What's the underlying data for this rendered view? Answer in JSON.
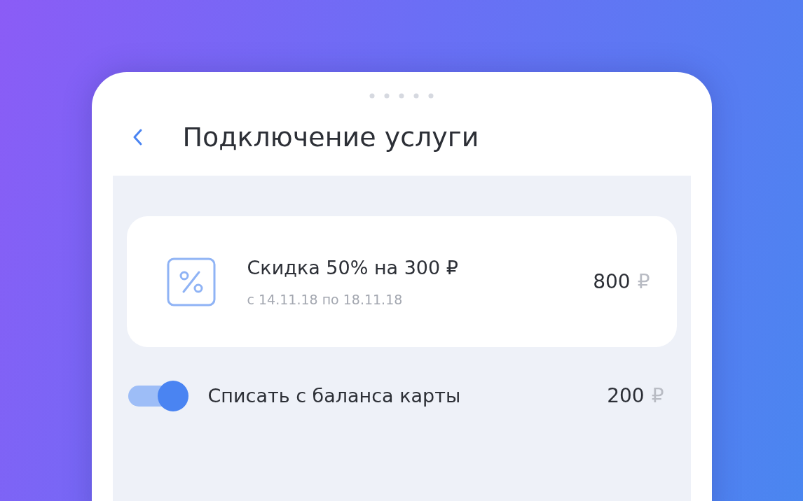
{
  "header": {
    "title": "Подключение услуги"
  },
  "offer": {
    "title": "Скидка 50% на 300 ₽",
    "period": "с 14.11.18 по 18.11.18",
    "amount": "800",
    "currency": "₽"
  },
  "balance_toggle": {
    "label": "Списать с баланса карты",
    "on": true,
    "amount": "200",
    "currency": "₽"
  }
}
